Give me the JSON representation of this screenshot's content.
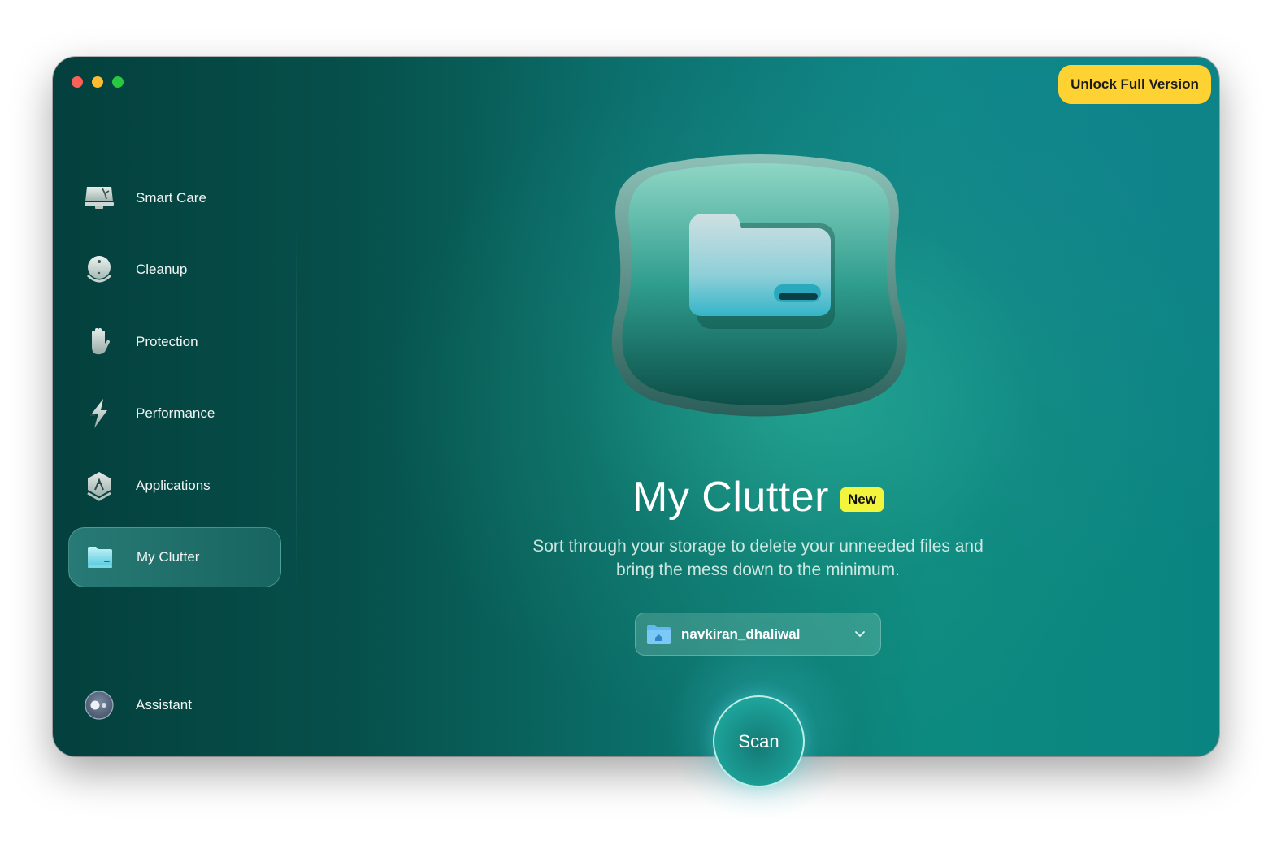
{
  "window": {
    "traffic_lights": [
      "close",
      "minimize",
      "maximize"
    ],
    "unlock_button": "Unlock Full Version"
  },
  "sidebar": {
    "items": [
      {
        "label": "Smart Care",
        "icon": "smart-care-icon"
      },
      {
        "label": "Cleanup",
        "icon": "cleanup-icon"
      },
      {
        "label": "Protection",
        "icon": "protection-hand-icon"
      },
      {
        "label": "Performance",
        "icon": "performance-bolt-icon"
      },
      {
        "label": "Applications",
        "icon": "applications-icon"
      },
      {
        "label": "My Clutter",
        "icon": "folder-icon",
        "active": true
      }
    ],
    "assistant": {
      "label": "Assistant",
      "icon": "assistant-icon"
    }
  },
  "main": {
    "title": "My Clutter",
    "badge": "New",
    "subtitle_line1": "Sort through your storage to delete your unneeded files and",
    "subtitle_line2": "bring the mess down to the minimum.",
    "folder_select": {
      "value": "navkiran_dhaliwal",
      "icon": "home-folder-icon"
    },
    "scan_button": "Scan"
  },
  "colors": {
    "accent_yellow": "#fdd232",
    "badge_yellow": "#f2f53c",
    "background_dark": "#04403d",
    "background_teal": "#0d8a80"
  }
}
